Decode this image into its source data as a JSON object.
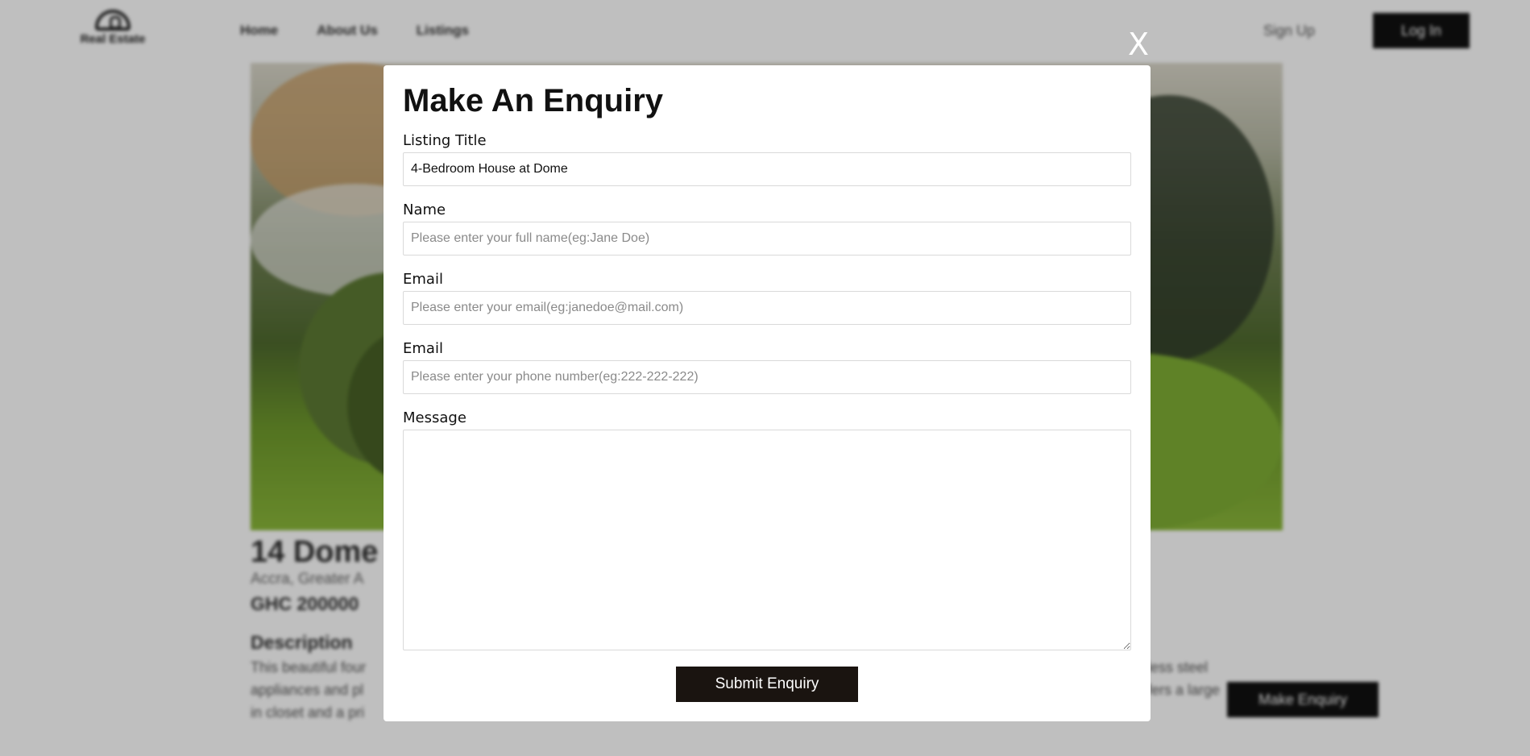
{
  "nav": {
    "logo_text": "Real Estate",
    "links": [
      "Home",
      "About Us",
      "Listings"
    ],
    "signup": "Sign Up",
    "login": "Log In"
  },
  "listing": {
    "title": "14 Dome",
    "address": "Accra, Greater A",
    "price": "GHC 200000",
    "description_heading": "Description",
    "description_lines": [
      "This beautiful four",
      "appliances and pl",
      "in closet and a pri"
    ],
    "description_right": [
      "less steel",
      "fers a large"
    ],
    "make_enquiry": "Make Enquiry"
  },
  "modal": {
    "close": "X",
    "title": "Make An Enquiry",
    "fields": [
      {
        "label": "Listing Title",
        "value": "4-Bedroom House at Dome",
        "placeholder": ""
      },
      {
        "label": "Name",
        "value": "",
        "placeholder": "Please enter your full name(eg:Jane Doe)"
      },
      {
        "label": "Email",
        "value": "",
        "placeholder": "Please enter your email(eg:janedoe@mail.com)"
      },
      {
        "label": "Email",
        "value": "",
        "placeholder": "Please enter your phone number(eg:222-222-222)"
      }
    ],
    "message_label": "Message",
    "message_value": "",
    "submit": "Submit Enquiry"
  }
}
